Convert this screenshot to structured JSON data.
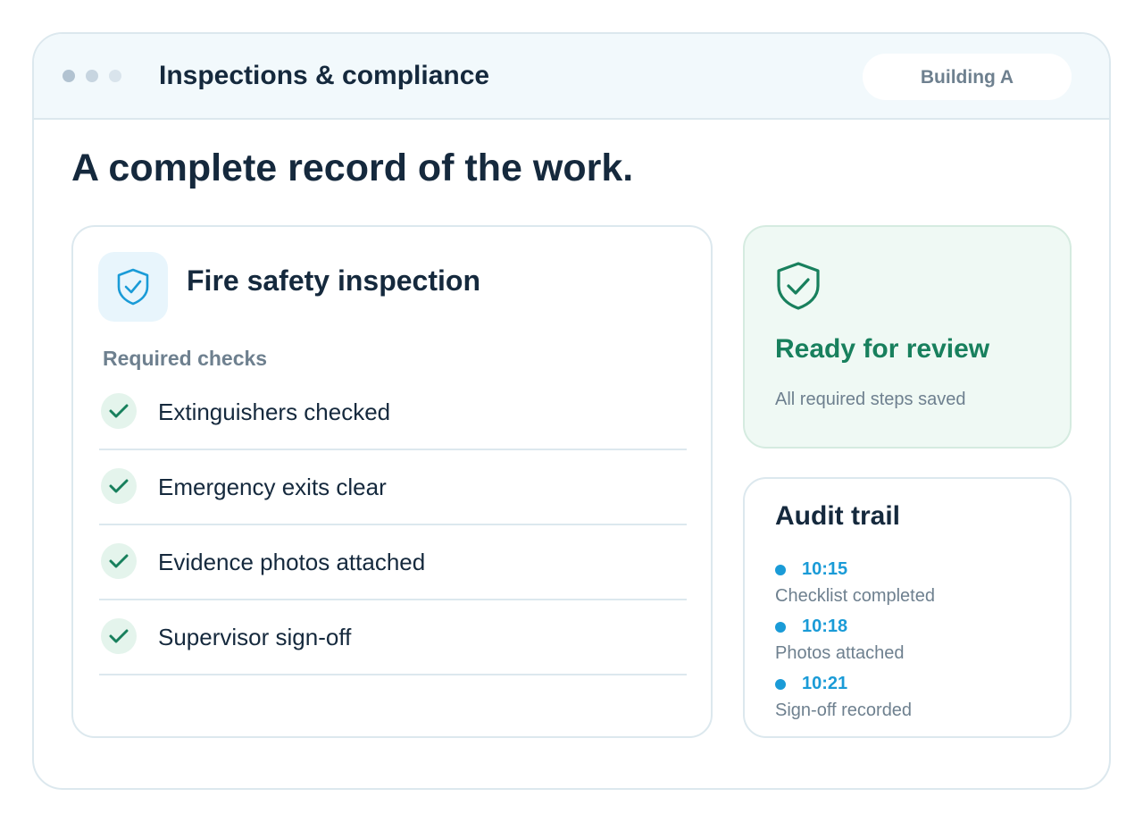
{
  "window": {
    "title": "Inspections & compliance",
    "location_pill": "Building A"
  },
  "headline": "A complete record of the work.",
  "inspection": {
    "icon": "shield-check-icon",
    "title": "Fire safety inspection",
    "section_label": "Required checks",
    "checks": [
      {
        "label": "Extinguishers checked",
        "done": true
      },
      {
        "label": "Emergency exits clear",
        "done": true
      },
      {
        "label": "Evidence photos attached",
        "done": true
      },
      {
        "label": "Supervisor sign-off",
        "done": true
      }
    ]
  },
  "review": {
    "icon": "shield-check-icon",
    "title": "Ready for review",
    "subtitle": "All required steps saved"
  },
  "audit": {
    "title": "Audit trail",
    "entries": [
      {
        "time": "10:15",
        "text": "Checklist completed"
      },
      {
        "time": "10:18",
        "text": "Photos attached"
      },
      {
        "time": "10:21",
        "text": "Sign-off recorded"
      }
    ]
  },
  "colors": {
    "accent_blue": "#1a9bd7",
    "success_green": "#18805d",
    "text_dark": "#15293d",
    "text_muted": "#6e808f",
    "border": "#dce8ee"
  }
}
